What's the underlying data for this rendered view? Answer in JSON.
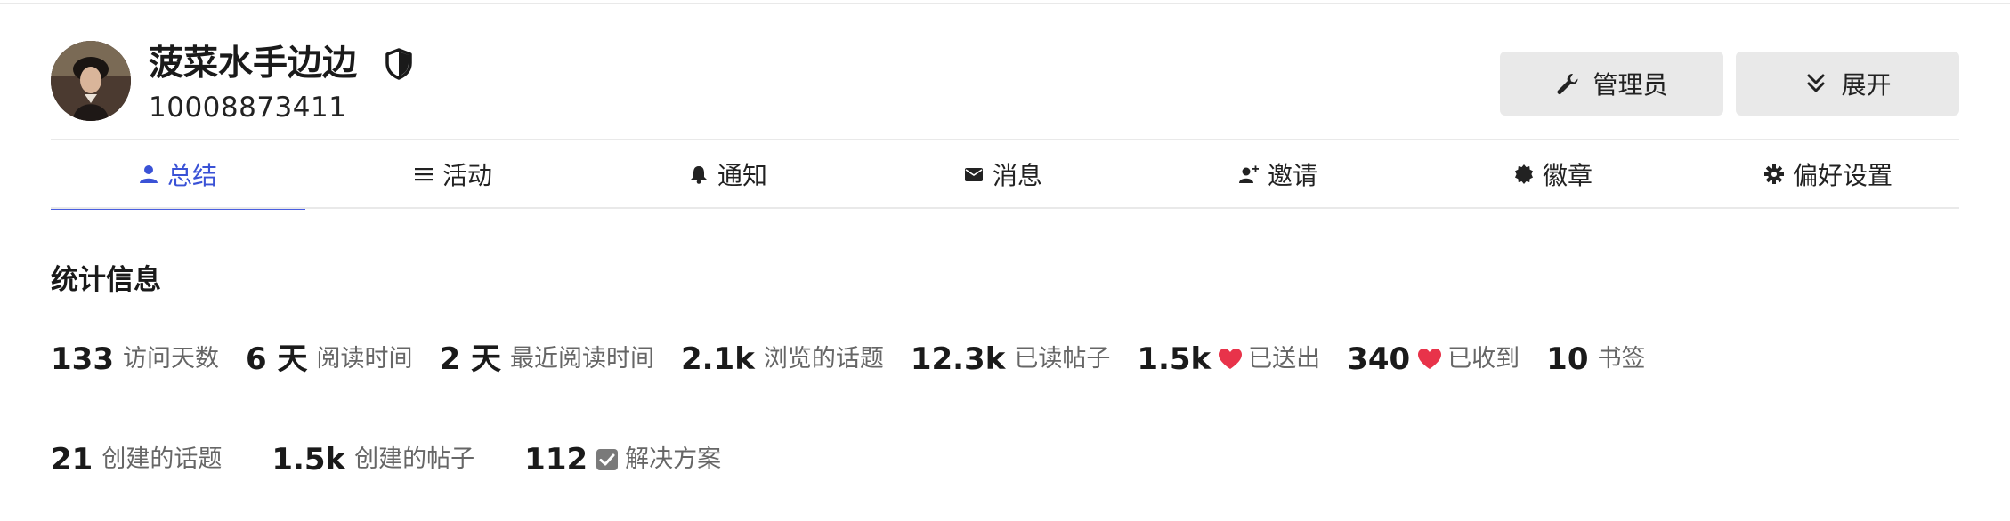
{
  "user": {
    "name": "菠菜水手边边",
    "id": "10008873411"
  },
  "buttons": {
    "admin": "管理员",
    "expand": "展开"
  },
  "tabs": [
    {
      "label": "总结",
      "icon": "user-icon",
      "active": true
    },
    {
      "label": "活动",
      "icon": "list-icon",
      "active": false
    },
    {
      "label": "通知",
      "icon": "bell-icon",
      "active": false
    },
    {
      "label": "消息",
      "icon": "envelope-icon",
      "active": false
    },
    {
      "label": "邀请",
      "icon": "user-plus-icon",
      "active": false
    },
    {
      "label": "徽章",
      "icon": "badge-icon",
      "active": false
    },
    {
      "label": "偏好设置",
      "icon": "gear-icon",
      "active": false
    }
  ],
  "stats": {
    "title": "统计信息",
    "row1": [
      {
        "value": "133",
        "label": "访问天数"
      },
      {
        "value": "6 天",
        "label": "阅读时间"
      },
      {
        "value": "2 天",
        "label": "最近阅读时间"
      },
      {
        "value": "2.1k",
        "label": "浏览的话题"
      },
      {
        "value": "12.3k",
        "label": "已读帖子"
      },
      {
        "value": "1.5k",
        "label": "已送出",
        "icon": "heart-icon"
      },
      {
        "value": "340",
        "label": "已收到",
        "icon": "heart-icon"
      },
      {
        "value": "10",
        "label": "书签"
      }
    ],
    "row2": [
      {
        "value": "21",
        "label": "创建的话题"
      },
      {
        "value": "1.5k",
        "label": "创建的帖子"
      },
      {
        "value": "112",
        "label": "解决方案",
        "icon": "checkbox-icon"
      }
    ]
  },
  "colors": {
    "accent": "#3a52d6",
    "heart": "#e8334a",
    "button_bg": "#e9e9e9",
    "muted_text": "#666666"
  }
}
